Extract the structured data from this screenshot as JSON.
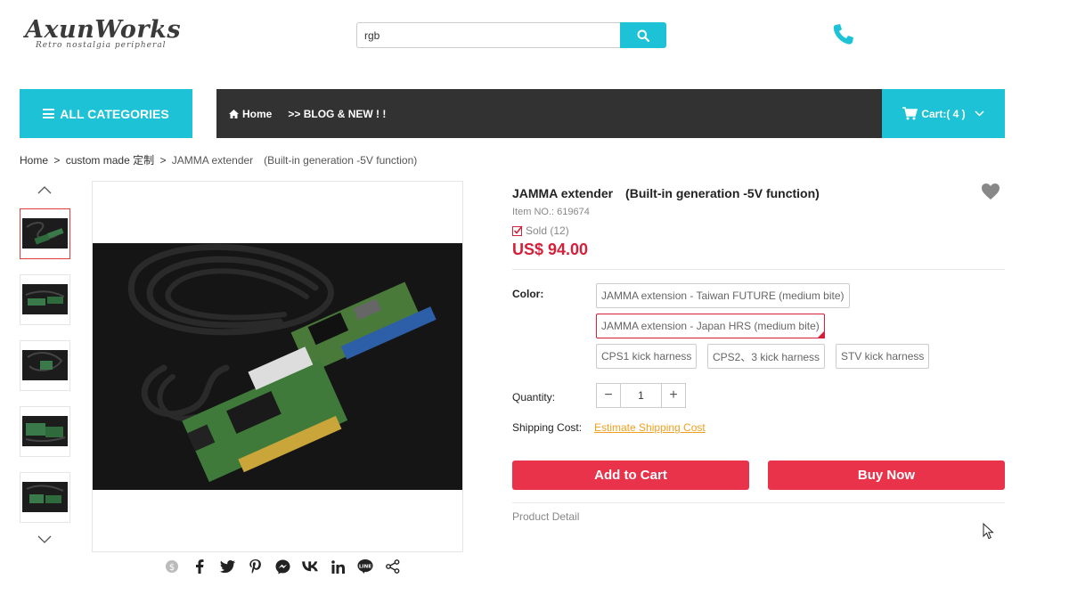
{
  "header": {
    "logo_main": "AxunWorks",
    "logo_sub": "Retro nostalgia peripheral",
    "search_value": "rgb",
    "icons": {
      "search": "search-icon",
      "phone": "phone-icon"
    }
  },
  "nav": {
    "all_categories": "ALL CATEGORIES",
    "items": [
      {
        "label": "Home",
        "icon": "home-icon"
      },
      {
        "label": ">> BLOG & NEW ! !"
      }
    ],
    "cart_label": "Cart:( 4 )"
  },
  "breadcrumb": {
    "items": [
      "Home",
      "custom made 定制",
      "JAMMA extender　(Built-in generation -5V function)"
    ],
    "separator": ">"
  },
  "product": {
    "title": "JAMMA extender　(Built-in generation -5V function)",
    "item_no": "Item NO.: 619674",
    "sold": "Sold (12)",
    "price": "US$ 94.00",
    "color_label": "Color:",
    "color_options": [
      {
        "label": "JAMMA extension - Taiwan FUTURE (medium bite)",
        "selected": false
      },
      {
        "label": "JAMMA extension - Japan HRS (medium bite)",
        "selected": true
      },
      {
        "label": "CPS1 kick harness",
        "selected": false
      },
      {
        "label": "CPS2、3 kick harness",
        "selected": false
      },
      {
        "label": "STV kick harness",
        "selected": false
      }
    ],
    "quantity_label": "Quantity:",
    "quantity_value": "1",
    "shipping_label": "Shipping Cost:",
    "shipping_link": "Estimate Shipping Cost",
    "add_to_cart": "Add to Cart",
    "buy_now": "Buy Now",
    "detail_tab": "Product Detail"
  },
  "share_icons": [
    "dollar-icon",
    "facebook-icon",
    "twitter-icon",
    "pinterest-icon",
    "messenger-icon",
    "vk-icon",
    "linkedin-icon",
    "line-icon",
    "share-icon"
  ],
  "colors": {
    "accent": "#1ec2d6",
    "navbar": "#323232",
    "price": "#d6203a",
    "button": "#e8334a",
    "link": "#f0a020"
  }
}
